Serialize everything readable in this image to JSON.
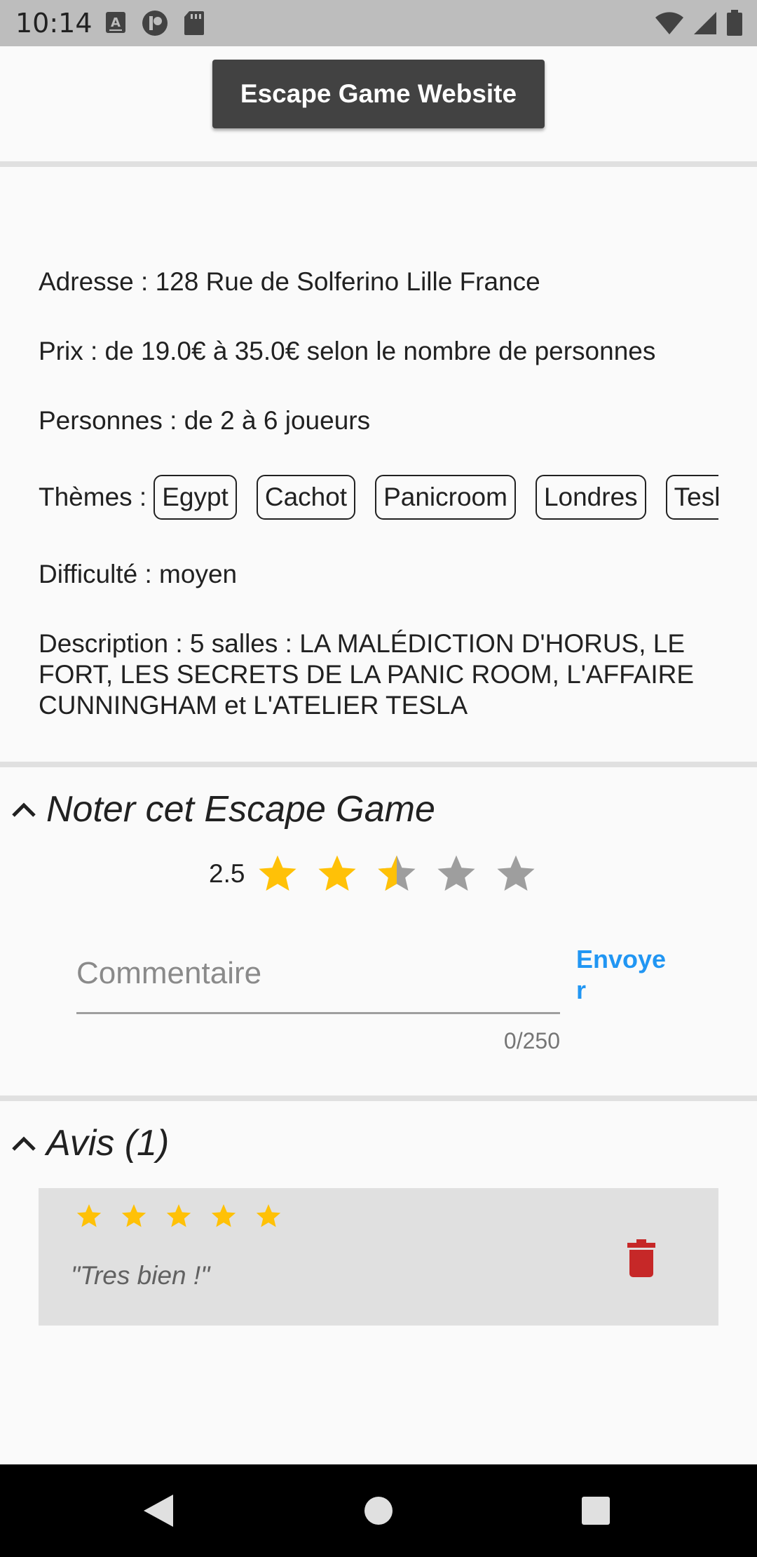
{
  "status_bar": {
    "time": "10:14",
    "left_icons": [
      "keyboard-a-icon",
      "app-notification-icon",
      "sd-card-icon"
    ],
    "right_icons": [
      "wifi-icon",
      "cell-signal-icon",
      "battery-icon"
    ]
  },
  "header": {
    "website_button_label": "Escape Game Website"
  },
  "info": {
    "address": "Adresse : 128 Rue de Solferino Lille France",
    "price": "Prix : de 19.0€ à 35.0€ selon le nombre de personnes",
    "players": "Personnes : de 2 à 6 joueurs",
    "themes_label": "Thèmes :",
    "themes": [
      "Egypt",
      "Cachot",
      "Panicroom",
      "Londres",
      "Tesla"
    ],
    "difficulty": "Difficulté : moyen",
    "description": "Description : 5 salles : LA MALÉDICTION D'HORUS, LE FORT, LES SECRETS DE LA PANIC ROOM, L'AFFAIRE CUNNINGHAM et L'ATELIER TESLA"
  },
  "rate_section": {
    "title": "Noter cet Escape Game",
    "rating_value": "2.5",
    "rating": 2.5,
    "max_rating": 5,
    "comment_placeholder": "Commentaire",
    "comment_value": "",
    "counter": "0/250",
    "send_label": "Envoyer"
  },
  "reviews_section": {
    "title": "Avis (1)",
    "reviews": [
      {
        "stars": 5,
        "comment": "\"Tres bien !\""
      }
    ]
  },
  "colors": {
    "star_filled": "#ffc107",
    "star_empty": "#9e9e9e",
    "accent": "#2196f3",
    "delete": "#c62828",
    "button_dark": "#424242"
  }
}
